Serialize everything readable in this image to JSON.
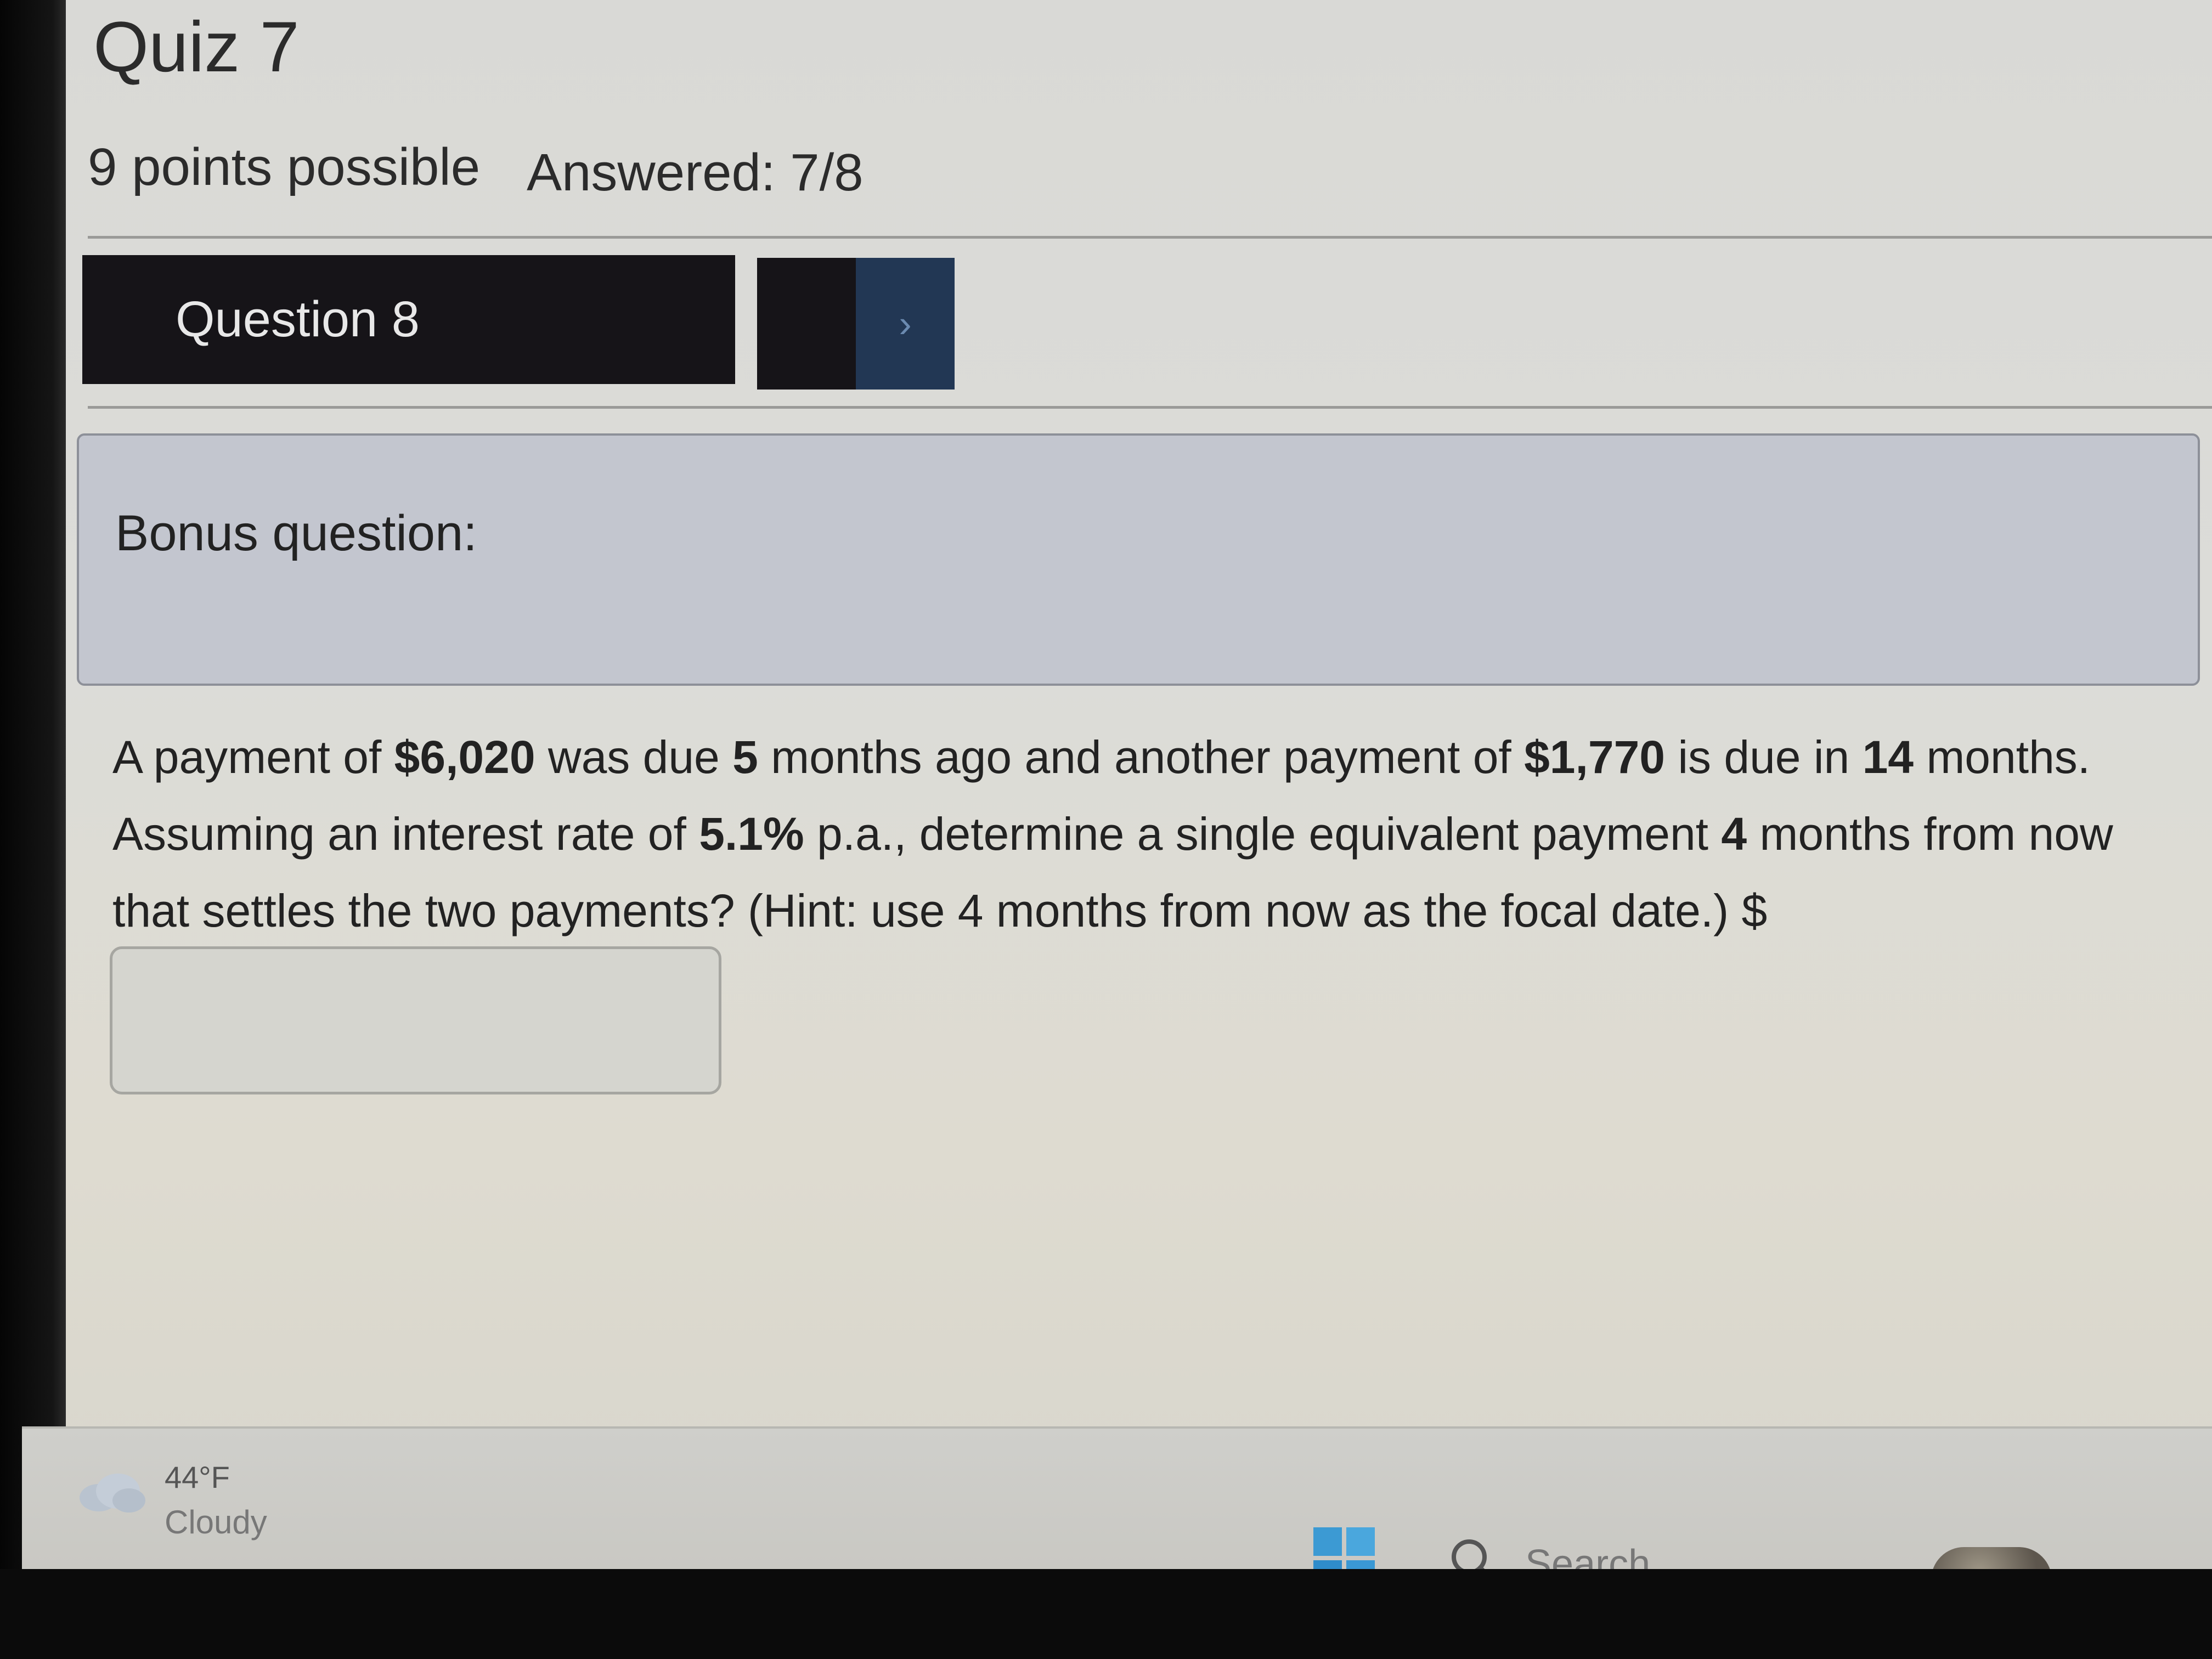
{
  "quiz": {
    "title": "Quiz 7",
    "points": "9 points possible",
    "answered": "Answered: 7/8"
  },
  "question_nav": {
    "label": "Question 8",
    "next_glyph": "›"
  },
  "bonus": {
    "label": "Bonus question:"
  },
  "question": {
    "seg1": "A payment of ",
    "amount1": "$6,020",
    "seg2": " was due ",
    "months1": "5",
    "seg3": " months ago and another payment of ",
    "amount2": "$1,770",
    "seg4": " is due in ",
    "months2": "14",
    "seg5": " months. Assuming an interest rate of ",
    "rate": "5.1%",
    "seg6": " p.a., determine a single equivalent payment ",
    "months3": "4",
    "seg7": " months from now that settles the two payments? (Hint: use 4 months from now as the focal date.) $"
  },
  "answer": {
    "value": "",
    "placeholder": ""
  },
  "taskbar": {
    "temperature": "44°F",
    "condition": "Cloudy",
    "search_label": "Search",
    "icons": [
      "cloud-icon",
      "windows-start-icon",
      "search-icon",
      "user-avatar",
      "app-icon"
    ]
  },
  "colors": {
    "question_bar": "#161418",
    "next_button": "#223754",
    "bonus_box": "#c3c6cf"
  }
}
